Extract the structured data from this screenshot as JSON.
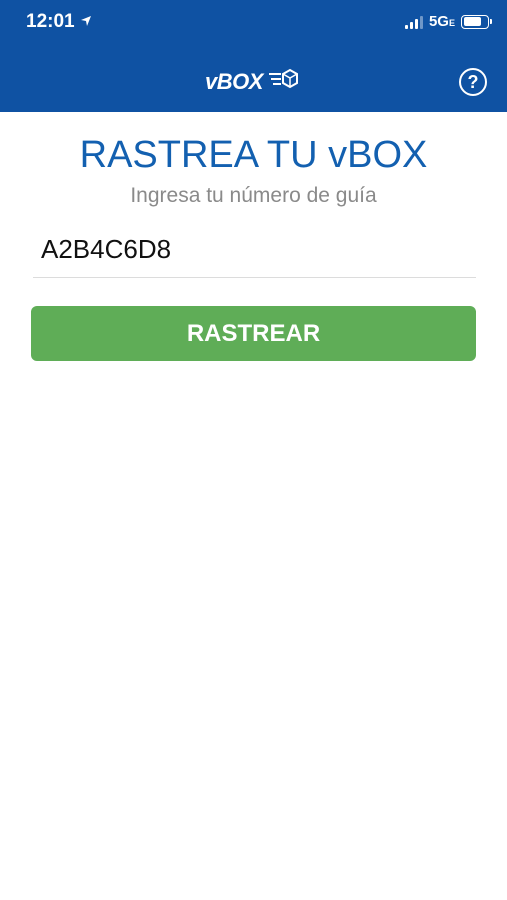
{
  "status_bar": {
    "time": "12:01",
    "network": "5G",
    "network_suffix": "E",
    "battery_level": 0.8
  },
  "header": {
    "logo_text": "vBOX",
    "help_label": "?"
  },
  "main": {
    "title": "RASTREA TU vBOX",
    "subtitle": "Ingresa tu número de guía",
    "tracking_input": {
      "value": "A2B4C6D8"
    },
    "track_button_label": "RASTREAR"
  },
  "colors": {
    "header_bg": "#0f52a3",
    "title": "#1360b0",
    "button": "#5fad57"
  },
  "icons": [
    "location-arrow-icon",
    "signal-icon",
    "battery-icon",
    "vbox-logo-icon",
    "help-icon"
  ]
}
